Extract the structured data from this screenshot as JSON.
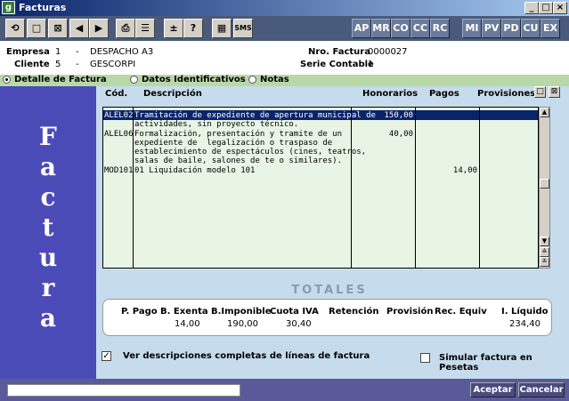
{
  "window": {
    "title": "Facturas",
    "app_icon": "g"
  },
  "toolbar": {
    "icons": [
      "refresh-icon",
      "new-icon",
      "delete-icon",
      "prev-icon",
      "next-icon",
      "print-icon",
      "list-icon",
      "plusminus-icon",
      "help-icon",
      "calculator-icon",
      "sms-icon"
    ],
    "sms_label": "SMS",
    "plusminus_label": "±",
    "help_label": "?",
    "codes_left": [
      "AP",
      "MR",
      "CO",
      "CC",
      "RC"
    ],
    "codes_right": [
      "MI",
      "PV",
      "PD",
      "CU",
      "EX"
    ]
  },
  "header": {
    "empresa_label": "Empresa",
    "empresa_num": "1",
    "empresa_sep": "-",
    "empresa_name": "DESPACHO A3",
    "cliente_label": "Cliente",
    "cliente_num": "5",
    "cliente_sep": "-",
    "cliente_name": "GESCORPI",
    "factura_label": "Nro. Factura",
    "factura_value": "0000027",
    "serie_label": "Serie Contable",
    "serie_value": "1"
  },
  "tabs": [
    {
      "label": "Detalle de Factura",
      "selected": true
    },
    {
      "label": "Datos Identificativos",
      "selected": false
    },
    {
      "label": "Notas",
      "selected": false
    }
  ],
  "sidebar": {
    "vertical_text": "Factura"
  },
  "grid": {
    "columns": [
      "Cód.",
      "Descripción",
      "Honorarios",
      "Pagos",
      "Provisiones"
    ],
    "rows": [
      {
        "code": "ALEL02",
        "desc": [
          "Tramitación de expediente de apertura municipal de",
          "actividades, sin proyecto técnico."
        ],
        "honorarios": "150,00",
        "pagos": "",
        "provisiones": "",
        "selected": true
      },
      {
        "code": "ALEL06",
        "desc": [
          "Formalización, presentación y tramite de un",
          "expediente de  legalización o traspaso de",
          "establecimiento de espectáculos (cines, teatros,",
          "salas de baile, salones de te o similares)."
        ],
        "honorarios": "40,00",
        "pagos": "",
        "provisiones": ""
      },
      {
        "code": "MOD101",
        "desc": [
          "01 Liquidación modelo 101"
        ],
        "honorarios": "",
        "pagos": "14,00",
        "provisiones": ""
      }
    ]
  },
  "totals": {
    "title": "TOTALES",
    "headers": [
      "P. Pago",
      "B. Exenta",
      "B.Imponible",
      "Cuota IVA",
      "Retención",
      "Provisión",
      "Rec. Equiv",
      "I. Líquido"
    ],
    "values": [
      "",
      "14,00",
      "190,00",
      "30,40",
      "",
      "",
      "",
      "234,40"
    ]
  },
  "options": {
    "ver_desc_label": "Ver descripciones completas de líneas de factura",
    "ver_desc_checked": true,
    "simular_label": "Simular factura en Pesetas",
    "simular_checked": false
  },
  "footer": {
    "status_text": "",
    "accept_label": "Aceptar",
    "cancel_label": "Cancelar"
  },
  "colors": {
    "titlebar": "#0a246a",
    "sidebar": "#4b4bb8",
    "content": "#c6dcec",
    "grid": "#e8f4e4",
    "selected_row": "#0a246a"
  }
}
